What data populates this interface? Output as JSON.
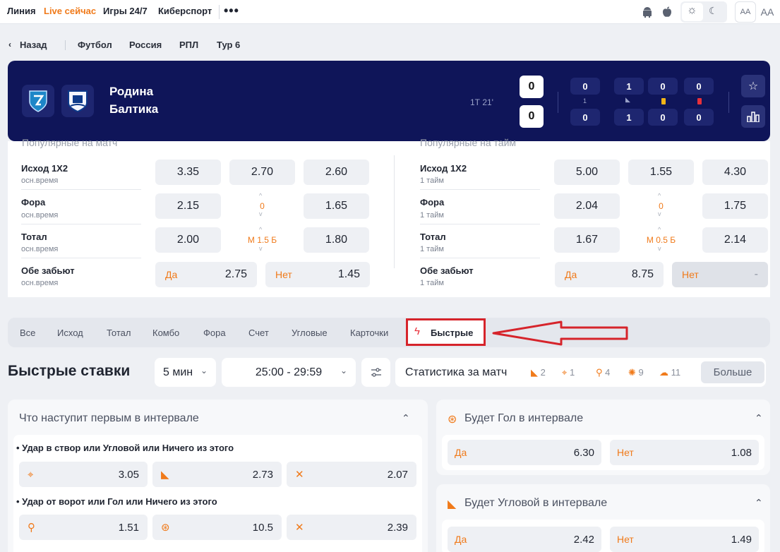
{
  "topnav": {
    "items": [
      "Линия",
      "Live сейчас",
      "Игры 24/7",
      "Киберспорт"
    ],
    "more": "•••",
    "font_small": "AA",
    "font_large": "AA"
  },
  "breadcrumb": {
    "back": "Назад",
    "items": [
      "Футбол",
      "Россия",
      "РПЛ",
      "Тур 6"
    ]
  },
  "match": {
    "team1": "Родина",
    "team2": "Балтика",
    "period": "1Т 21'",
    "score1": "0",
    "score2": "0",
    "stats": {
      "team1": [
        "0",
        "1",
        "0",
        "0"
      ],
      "team2": [
        "0",
        "1",
        "0",
        "0"
      ],
      "mid_label": "1"
    }
  },
  "markets": {
    "left_heading": "Популярные на матч",
    "right_heading": "Популярные на тайм",
    "left": [
      {
        "label": "Исход 1X2",
        "sub": "осн.время",
        "odds": [
          "3.35",
          "2.70",
          "2.60"
        ]
      },
      {
        "label": "Фора",
        "sub": "осн.время",
        "odds": [
          "2.15",
          "0",
          "1.65"
        ]
      },
      {
        "label": "Тотал",
        "sub": "осн.время",
        "odds": [
          "2.00",
          "М 1.5 Б",
          "1.80"
        ]
      },
      {
        "label": "Обе забьют",
        "sub": "осн.время",
        "yes_label": "Да",
        "yes": "2.75",
        "no_label": "Нет",
        "no": "1.45"
      }
    ],
    "right": [
      {
        "label": "Исход 1X2",
        "sub": "1 тайм",
        "odds": [
          "5.00",
          "1.55",
          "4.30"
        ]
      },
      {
        "label": "Фора",
        "sub": "1 тайм",
        "odds": [
          "2.04",
          "0",
          "1.75"
        ]
      },
      {
        "label": "Тотал",
        "sub": "1 тайм",
        "odds": [
          "1.67",
          "М 0.5 Б",
          "2.14"
        ]
      },
      {
        "label": "Обе забьют",
        "sub": "1 тайм",
        "yes_label": "Да",
        "yes": "8.75",
        "no_label": "Нет",
        "no": "-"
      }
    ]
  },
  "tabs": [
    "Все",
    "Исход",
    "Тотал",
    "Комбо",
    "Фора",
    "Счет",
    "Угловые",
    "Карточки",
    "Быстрые"
  ],
  "quick": {
    "title": "Быстрые ставки",
    "interval": "5 мин",
    "range": "25:00 - 29:59",
    "stats_label": "Статистика за матч",
    "stats": [
      "2",
      "1",
      "4",
      "9",
      "11"
    ],
    "more": "Больше"
  },
  "cards": {
    "first": {
      "title": "Что наступит первым в интервале",
      "q1": "Удар в створ или Угловой или Ничего из этого",
      "q1_odds": [
        "3.05",
        "2.73",
        "2.07"
      ],
      "q2": "Удар от ворот или Гол или Ничего из этого",
      "q2_odds": [
        "1.51",
        "10.5",
        "2.39"
      ]
    },
    "goal": {
      "title": "Будет Гол в интервале",
      "yes_label": "Да",
      "yes": "6.30",
      "no_label": "Нет",
      "no": "1.08"
    },
    "corner": {
      "title": "Будет Угловой в интервале",
      "yes_label": "Да",
      "yes": "2.42",
      "no_label": "Нет",
      "no": "1.49"
    }
  },
  "colors": {
    "accent": "#f07a1a",
    "header_bg": "#0f1559",
    "highlight": "#d6242b"
  }
}
